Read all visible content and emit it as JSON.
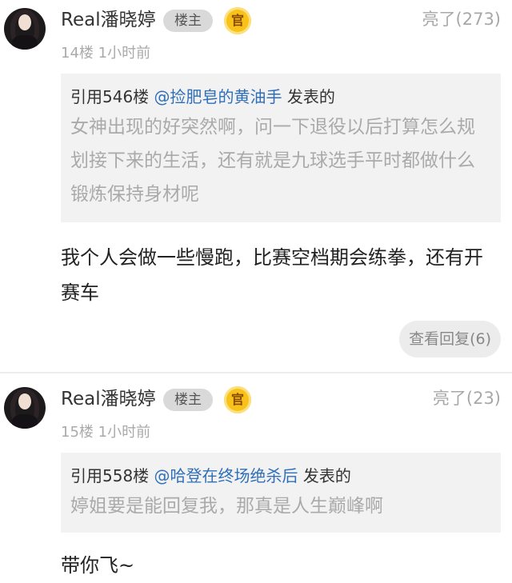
{
  "posts": [
    {
      "username": "Real潘晓婷",
      "owner_badge": "楼主",
      "official_badge": "官",
      "likes": "亮了(273)",
      "floor": "14楼",
      "time": "1小时前",
      "quote": {
        "prefix": "引用546楼 ",
        "user": "@捡肥皂的黄油手",
        "suffix": " 发表的",
        "body": "女神出现的好突然啊，问一下退役以后打算怎么规划接下来的生活，还有就是九球选手平时都做什么锻炼保持身材呢"
      },
      "reply": "我个人会做一些慢跑，比赛空档期会练拳，还有开赛车",
      "view_replies": "查看回复(6)"
    },
    {
      "username": "Real潘晓婷",
      "owner_badge": "楼主",
      "official_badge": "官",
      "likes": "亮了(23)",
      "floor": "15楼",
      "time": "1小时前",
      "quote": {
        "prefix": "引用558楼 ",
        "user": "@哈登在终场绝杀后",
        "suffix": " 发表的",
        "body": "婷姐要是能回复我，那真是人生巅峰啊"
      },
      "reply": "带你飞~"
    }
  ],
  "colors": {
    "link": "#2f6fb8",
    "quote_bg": "#f2f2f2",
    "badge_official": "#f8c21a",
    "muted_text": "#aaaaaa"
  },
  "icons": {
    "official": "official-badge-icon",
    "avatar": "avatar-image"
  }
}
